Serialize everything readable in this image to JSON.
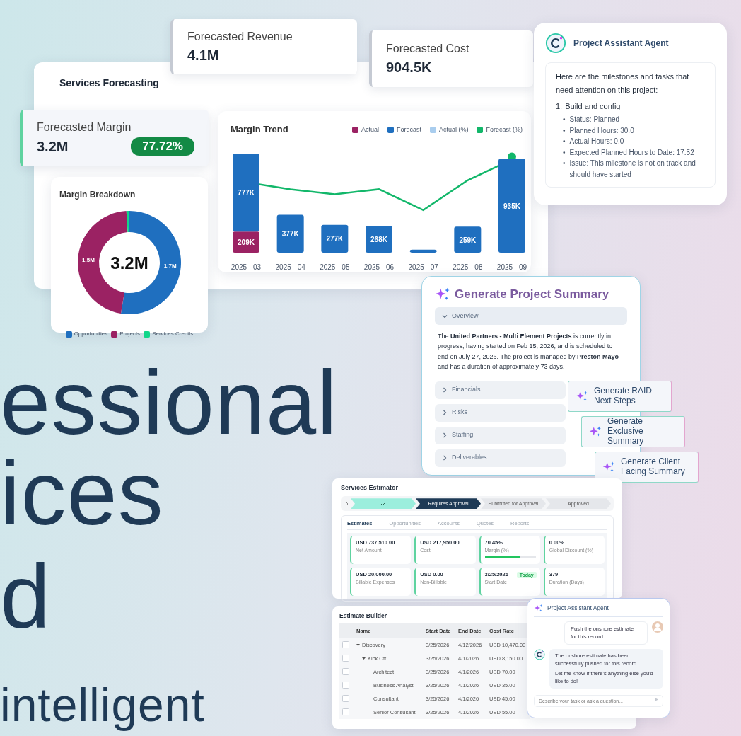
{
  "hero": {
    "lines": [
      "essional",
      "ices",
      "d"
    ],
    "subline": "intelligent"
  },
  "forecasting": {
    "title": "Services Forecasting",
    "kpis": [
      {
        "label": "Forecasted Revenue",
        "value": "4.1M"
      },
      {
        "label": "Forecasted Cost",
        "value": "904.5K"
      },
      {
        "label": "Forecasted Margin",
        "value": "3.2M",
        "badge": "77.72%"
      }
    ],
    "margin_trend": {
      "title": "Margin Trend",
      "percent_legend": [
        {
          "name": "Actual (%)",
          "color": "#a9cdee"
        },
        {
          "name": "Forecast (%)",
          "color": "#12b76a"
        }
      ],
      "chart_data": {
        "type": "bar",
        "stacked": true,
        "categories": [
          "2025 - 03",
          "2025 - 04",
          "2025 - 05",
          "2025 - 06",
          "2025 - 07",
          "2025 - 08",
          "2025 - 09"
        ],
        "series": [
          {
            "name": "Actual",
            "color": "#9b2263",
            "values": [
              209,
              null,
              null,
              null,
              null,
              null,
              null
            ],
            "value_labels": [
              "209K",
              null,
              null,
              null,
              null,
              null,
              null
            ]
          },
          {
            "name": "Forecast",
            "color": "#1f6fbf",
            "values": [
              777,
              377,
              277,
              268,
              30,
              259,
              935
            ],
            "value_labels": [
              "777K",
              "377K",
              "277K",
              "268K",
              null,
              "259K",
              "935K"
            ]
          }
        ]
      }
    },
    "margin_breakdown": {
      "title": "Margin Breakdown",
      "center": "3.2M",
      "chart_data": {
        "type": "donut",
        "categories": [
          "Opportunities",
          "Projects",
          "Services Credits"
        ],
        "values": [
          1.7,
          1.5,
          0.03
        ],
        "colors": [
          "#1f6fbf",
          "#9b2263",
          "#12d68a"
        ],
        "value_labels": [
          "1.7M",
          "1.5M",
          null
        ]
      }
    }
  },
  "assistant_top": {
    "title": "Project Assistant Agent",
    "intro": "Here are the milestones and tasks that need attention on this project:",
    "items": [
      {
        "number": "1.",
        "title": "Build and config",
        "marker": "•",
        "bullets": [
          "Status: Planned",
          "Planned Hours: 30.0",
          "Actual Hours: 0.0",
          "Expected Planned Hours to Date: 17.52",
          "Issue: This milestone is not on track and should have started"
        ]
      }
    ]
  },
  "summary": {
    "title": "Generate Project Summary",
    "sections": [
      {
        "label": "Overview",
        "expanded": true,
        "body": "The **United Partners - Multi Element Projects** is currently in progress, having started on Feb 15, 2026, and is scheduled to end on July 27, 2026. The project is managed by **Preston Mayo** and has a duration of approximately 73 days."
      },
      {
        "label": "Financials",
        "expanded": false
      },
      {
        "label": "Risks",
        "expanded": false
      },
      {
        "label": "Staffing",
        "expanded": false
      },
      {
        "label": "Deliverables",
        "expanded": false
      }
    ],
    "actions": [
      "Generate RAID Next Steps",
      "Generate Exclusive Summary",
      "Generate Client Facing Summary"
    ]
  },
  "estimator": {
    "title": "Services Estimator",
    "steps": [
      {
        "kind": "done"
      },
      {
        "kind": "current",
        "label": "Requires Approval"
      },
      {
        "kind": "pending",
        "label": "Submitted for Approval"
      },
      {
        "kind": "pending",
        "label": "Approved"
      }
    ],
    "tabs": [
      {
        "label": "Estimates",
        "selected": true
      },
      {
        "label": "Opportunities",
        "selected": false
      },
      {
        "label": "Accounts",
        "selected": false
      },
      {
        "label": "Quotes",
        "selected": false
      },
      {
        "label": "Reports",
        "selected": false
      }
    ],
    "metrics": [
      {
        "value": "USD 737,510.00",
        "label": "Net Amount"
      },
      {
        "value": "USD 217,950.00",
        "label": "Cost"
      },
      {
        "value": "70.45%",
        "label": "Margin (%)",
        "level": 0.7
      },
      {
        "value": "0.00%",
        "label": "Global Discount (%)"
      },
      {
        "value": "USD 20,000.00",
        "label": "Billable Expenses"
      },
      {
        "value": "USD 0.00",
        "label": "Non-Billable"
      },
      {
        "value": "3/25/2026",
        "label": "Start Date",
        "badge": "Today"
      },
      {
        "value": "379",
        "label": "Duration (Days)"
      }
    ]
  },
  "builder": {
    "title": "Estimate Builder",
    "columns": [
      "Name",
      "Start Date",
      "End Date",
      "Cost Rate"
    ],
    "rows": [
      {
        "name": "Discovery",
        "start": "3/25/2026",
        "end": "4/12/2026",
        "rate": "USD 10,470.00",
        "checked": false,
        "expanded": true,
        "children": [
          {
            "name": "Kick Off",
            "start": "3/25/2026",
            "end": "4/1/2026",
            "rate": "USD 8,150.00",
            "checked": false,
            "expanded": true,
            "children": [
              {
                "name": "Architect",
                "start": "3/25/2026",
                "end": "4/1/2026",
                "rate": "USD 70.00",
                "checked": false
              },
              {
                "name": "Business Analyst",
                "start": "3/25/2026",
                "end": "4/1/2026",
                "rate": "USD 35.00",
                "checked": false
              },
              {
                "name": "Consultant",
                "start": "3/25/2026",
                "end": "4/1/2026",
                "rate": "USD 45.00",
                "checked": false
              },
              {
                "name": "Senior Consultant",
                "start": "3/25/2026",
                "end": "4/1/2026",
                "rate": "USD 55.00",
                "checked": false
              }
            ]
          }
        ]
      }
    ]
  },
  "chat": {
    "title": "Project Assistant Agent",
    "messages": [
      {
        "kind": "user",
        "text": "Push the onshore estimate for this record."
      },
      {
        "kind": "agent",
        "paragraphs": [
          "The onshore estimate has been successfully pushed for this record.",
          "Let me know if there's anything else you'd like to do!"
        ]
      }
    ],
    "input": {
      "placeholder": "Describe your task or ask a question..."
    }
  }
}
